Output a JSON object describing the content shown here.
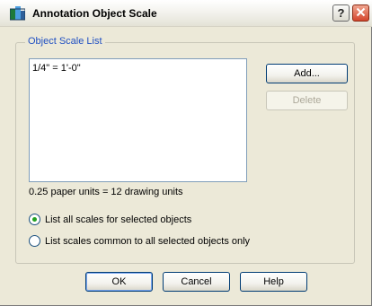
{
  "window": {
    "title": "Annotation Object Scale",
    "help_glyph": "?",
    "close_glyph": "X"
  },
  "group": {
    "legend": "Object Scale List"
  },
  "list": {
    "items": [
      "1/4\" = 1'-0\""
    ]
  },
  "buttons": {
    "add": "Add...",
    "delete": "Delete",
    "ok": "OK",
    "cancel": "Cancel",
    "help": "Help"
  },
  "info": "0.25 paper units = 12 drawing units",
  "options": {
    "all_scales": "List all scales for selected objects",
    "common_scales": "List scales common to all selected objects only",
    "selected": "all_scales"
  },
  "colors": {
    "accent": "#1f4fc2",
    "close_button": "#e0452e",
    "radio_dot": "#21a121"
  },
  "icons": {
    "app": "annotation-scale-icon",
    "help": "help-question-icon",
    "close": "close-x-icon"
  }
}
